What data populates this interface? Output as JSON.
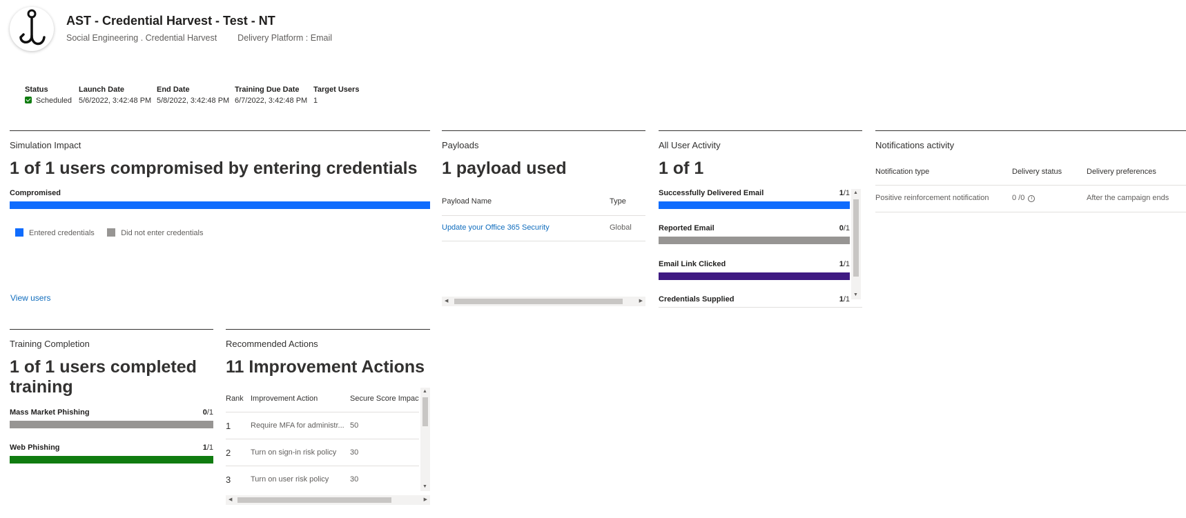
{
  "header": {
    "title": "AST - Credential Harvest - Test - NT",
    "technique": "Social Engineering . Credential Harvest",
    "delivery": "Delivery Platform : Email",
    "logo_icon": "fish-hook-icon"
  },
  "status_row": {
    "columns": [
      {
        "label": "Status",
        "value": "Scheduled"
      },
      {
        "label": "Launch Date",
        "value": "5/6/2022, 3:42:48 PM"
      },
      {
        "label": "End Date",
        "value": "5/8/2022, 3:42:48 PM"
      },
      {
        "label": "Training Due Date",
        "value": "6/7/2022, 3:42:48 PM"
      },
      {
        "label": "Target Users",
        "value": "1"
      }
    ]
  },
  "simulation_impact": {
    "title": "Simulation Impact",
    "headline": "1 of 1 users compromised by entering credentials",
    "bar_label": "Compromised",
    "compromised_fraction": 1.0,
    "legend": [
      "Entered credentials",
      "Did not enter credentials"
    ],
    "view_users": "View users"
  },
  "payloads": {
    "title": "Payloads",
    "headline": "1 payload used",
    "columns": [
      "Payload Name",
      "Type"
    ],
    "rows": [
      {
        "name": "Update your Office 365 Security",
        "type": "Global"
      }
    ]
  },
  "user_activity": {
    "title": "All User Activity",
    "headline": "1 of 1",
    "items": [
      {
        "label": "Successfully Delivered Email",
        "num": "1",
        "den": "/1",
        "fraction": 1.0,
        "color": "#0f6cfd"
      },
      {
        "label": "Reported Email",
        "num": "0",
        "den": "/1",
        "fraction": 1.0,
        "color": "#979593"
      },
      {
        "label": "Email Link Clicked",
        "num": "1",
        "den": "/1",
        "fraction": 1.0,
        "color": "#3f1a82"
      },
      {
        "label": "Credentials Supplied",
        "num": "1",
        "den": "/1",
        "fraction": 1.0,
        "color": "#0f6cfd"
      }
    ]
  },
  "notifications": {
    "title": "Notifications activity",
    "columns": [
      "Notification type",
      "Delivery status",
      "Delivery preferences"
    ],
    "rows": [
      {
        "type": "Positive reinforcement notification",
        "status": "0 /0",
        "preference": "After the campaign ends"
      }
    ]
  },
  "training": {
    "title": "Training Completion",
    "headline_1": "1 of 1 users completed",
    "headline_2": "training",
    "items": [
      {
        "label": "Mass Market Phishing",
        "num": "0",
        "den": "/1",
        "fraction": 1.0,
        "color": "#979593"
      },
      {
        "label": "Web Phishing",
        "num": "1",
        "den": "/1",
        "fraction": 1.0,
        "color": "#107c10"
      }
    ]
  },
  "recommended": {
    "title": "Recommended Actions",
    "headline": "11 Improvement Actions",
    "columns": [
      "Rank",
      "Improvement Action",
      "Secure Score Impact"
    ],
    "rows": [
      {
        "rank": "1",
        "action": "Require MFA for administr...",
        "impact": "50"
      },
      {
        "rank": "2",
        "action": "Turn on sign-in risk policy",
        "impact": "30"
      },
      {
        "rank": "3",
        "action": "Turn on user risk policy",
        "impact": "30"
      }
    ]
  },
  "colors": {
    "blue": "#0f6cfd",
    "gray": "#979593",
    "purple": "#3f1a82",
    "green": "#107c10",
    "link": "#0f6cbd"
  }
}
